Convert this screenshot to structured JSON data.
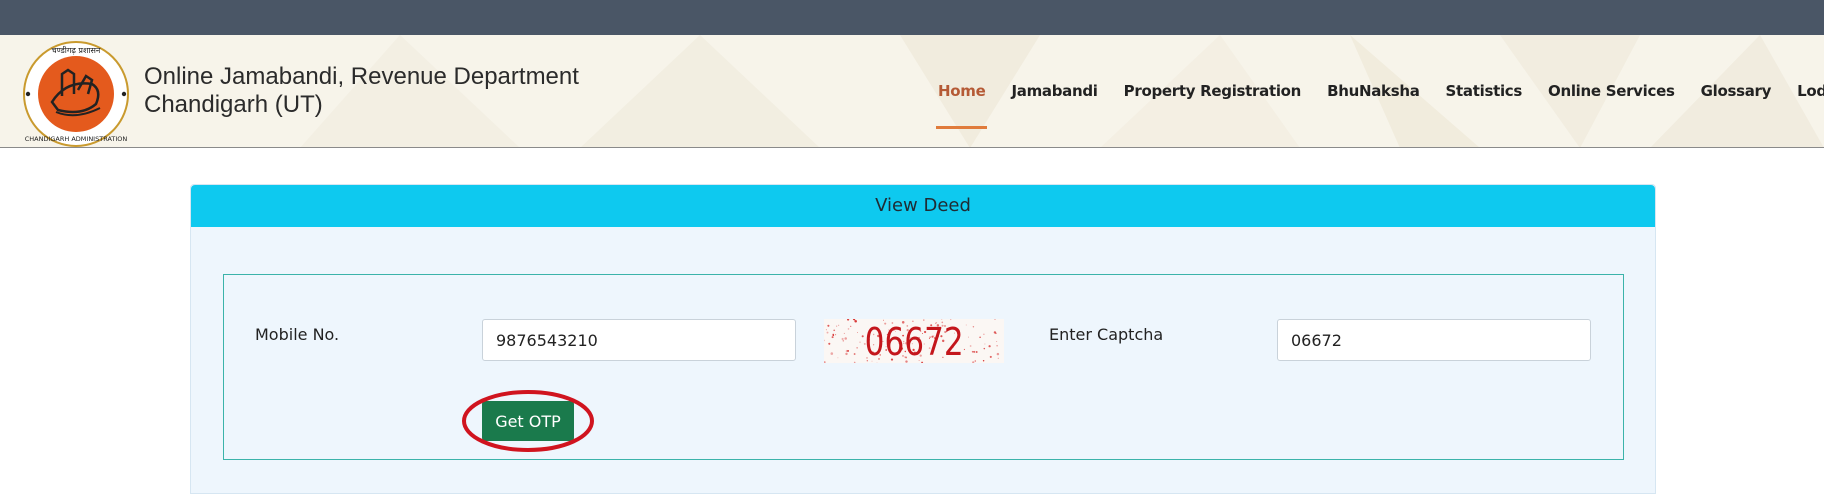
{
  "site": {
    "title_line1": "Online Jamabandi, Revenue Department",
    "title_line2": "Chandigarh (UT)",
    "logo": {
      "top_text": "चण्डीगढ़ प्रशासन",
      "bottom_text": "CHANDIGARH ADMINISTRATION"
    }
  },
  "nav": {
    "items": [
      {
        "label": "Home",
        "active": true
      },
      {
        "label": "Jamabandi"
      },
      {
        "label": "Property Registration"
      },
      {
        "label": "BhuNaksha"
      },
      {
        "label": "Statistics"
      },
      {
        "label": "Online Services"
      },
      {
        "label": "Glossary"
      },
      {
        "label": "Lodge Grievance"
      }
    ]
  },
  "view_deed": {
    "title": "View Deed",
    "mobile_label": "Mobile No.",
    "mobile_value": "9876543210",
    "captcha_image_text": "06672",
    "captcha_label": "Enter Captcha",
    "captcha_value": "06672",
    "otp_button_label": "Get OTP"
  },
  "colors": {
    "topbar": "#4a5666",
    "card_header": "#0ec9ef",
    "button": "#1a7a4c",
    "active_nav": "#b55a35",
    "highlight": "#d0141f"
  }
}
